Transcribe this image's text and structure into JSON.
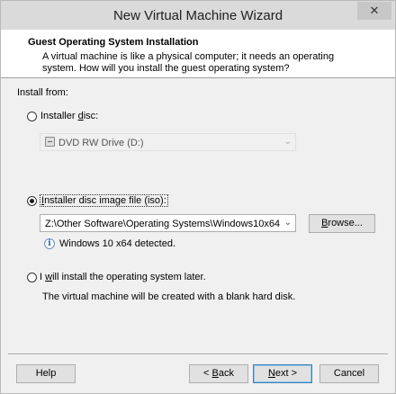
{
  "window": {
    "title": "New Virtual Machine Wizard",
    "close_glyph": "✕"
  },
  "header": {
    "title": "Guest Operating System Installation",
    "description": "A virtual machine is like a physical computer; it needs an operating system. How will you install the guest operating system?"
  },
  "install_from": {
    "label": "Install from:",
    "installer_disc": {
      "label_prefix": "Installer ",
      "label_accel": "d",
      "label_suffix": "isc:",
      "selected": false,
      "drive": {
        "icon": "dvd-drive-icon",
        "value": "DVD RW Drive (D:)",
        "enabled": false
      }
    },
    "iso": {
      "label_accel": "I",
      "label_rest": "nstaller disc image file (iso):",
      "selected": true,
      "path": "Z:\\Other Software\\Operating Systems\\Windows10x64",
      "browse_label_accel": "B",
      "browse_label_rest": "rowse...",
      "detected_icon": "info-icon",
      "detected_text": "Windows 10 x64 detected."
    },
    "later": {
      "label_prefix": "I ",
      "label_accel": "w",
      "label_suffix": "ill install the operating system later.",
      "selected": false,
      "description": "The virtual machine will be created with a blank hard disk."
    }
  },
  "buttons": {
    "help": "Help",
    "back_prefix": "< ",
    "back_accel": "B",
    "back_rest": "ack",
    "next_accel": "N",
    "next_rest": "ext >",
    "cancel": "Cancel"
  }
}
